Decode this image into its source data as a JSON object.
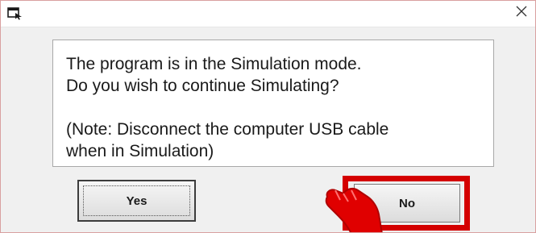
{
  "dialog": {
    "title": "",
    "icon": "window-icon",
    "close_icon": "close-icon"
  },
  "message": {
    "line1": "The program is in the Simulation mode.",
    "line2": "Do you wish to continue Simulating?",
    "line3": "(Note: Disconnect the computer USB cable",
    "line4": "when in Simulation)"
  },
  "buttons": {
    "yes_label": "Yes",
    "no_label": "No"
  },
  "colors": {
    "highlight": "#d40000",
    "background": "#f0f0f0"
  }
}
